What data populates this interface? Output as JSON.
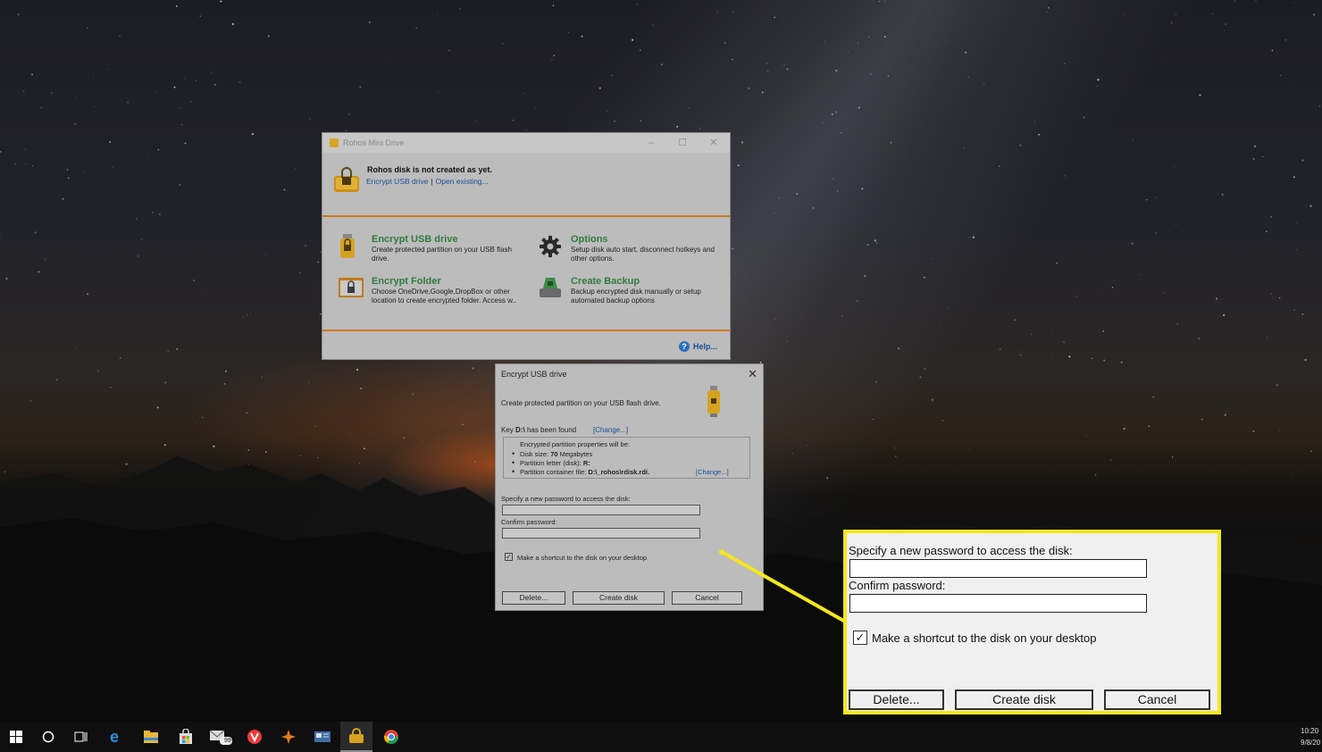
{
  "rohos_window": {
    "title": "Rohos Mini Drive",
    "status": "Rohos disk is not created as yet.",
    "link_encrypt": "Encrypt USB drive",
    "link_separator": "|",
    "link_open": "Open existing...",
    "actions": [
      {
        "title": "Encrypt USB drive",
        "description": "Create protected partition on your USB flash drive."
      },
      {
        "title": "Options",
        "description": "Setup disk auto start, disconnect hotkeys and other options."
      },
      {
        "title": "Encrypt Folder",
        "description": "Choose OneDrive,Google,DropBox or other location to create encrypted folder. Access w.."
      },
      {
        "title": "Create Backup",
        "description": "Backup encrypted disk manually or setup automated backup options"
      }
    ],
    "help": "Help..."
  },
  "encrypt_dialog": {
    "title": "Encrypt USB drive",
    "description": "Create protected partition on your USB flash drive.",
    "key_prefix": "Key",
    "key_drive": "D:\\",
    "key_suffix": "has been found",
    "change_link": "[Change...]",
    "properties_header": "Encrypted partition properties will be:",
    "disk_size_label": "Disk size:",
    "disk_size_value": "70",
    "disk_size_unit": "Megabytes",
    "partition_letter_label": "Partition letter (disk):",
    "partition_letter_value": "R:",
    "container_label": "Partition container file:",
    "container_value": "D:\\_rohos\\rdisk.rdi.",
    "container_change": "[Change...]",
    "password_label": "Specify a new password to access the disk:",
    "confirm_label": "Confirm password:",
    "password_value": "",
    "confirm_value": "",
    "shortcut_label": "Make a shortcut to the disk on your desktop",
    "shortcut_checked": true,
    "buttons": {
      "delete": "Delete...",
      "create": "Create disk",
      "cancel": "Cancel"
    }
  },
  "zoom_callout": {
    "password_label": "Specify a new password to access the disk:",
    "confirm_label": "Confirm password:",
    "shortcut_label": "Make a shortcut to the disk on your desktop",
    "check_mark": "✓",
    "buttons": {
      "delete": "Delete...",
      "create": "Create disk",
      "cancel": "Cancel"
    },
    "highlight_color": "#f4e61f"
  },
  "taskbar": {
    "icons": [
      "windows-start-icon",
      "cortana-search-icon",
      "task-view-icon",
      "edge-icon",
      "file-explorer-icon",
      "store-icon",
      "mail-icon",
      "vivaldi-icon",
      "app-icon",
      "news-app-icon",
      "rohos-icon",
      "chrome-icon"
    ],
    "mail_badge": "99+",
    "time": "10:20",
    "date": "9/8/20"
  },
  "colors": {
    "accent_orange": "#cc7a19",
    "action_green": "#327a3d",
    "link_blue": "#1a4f99"
  }
}
